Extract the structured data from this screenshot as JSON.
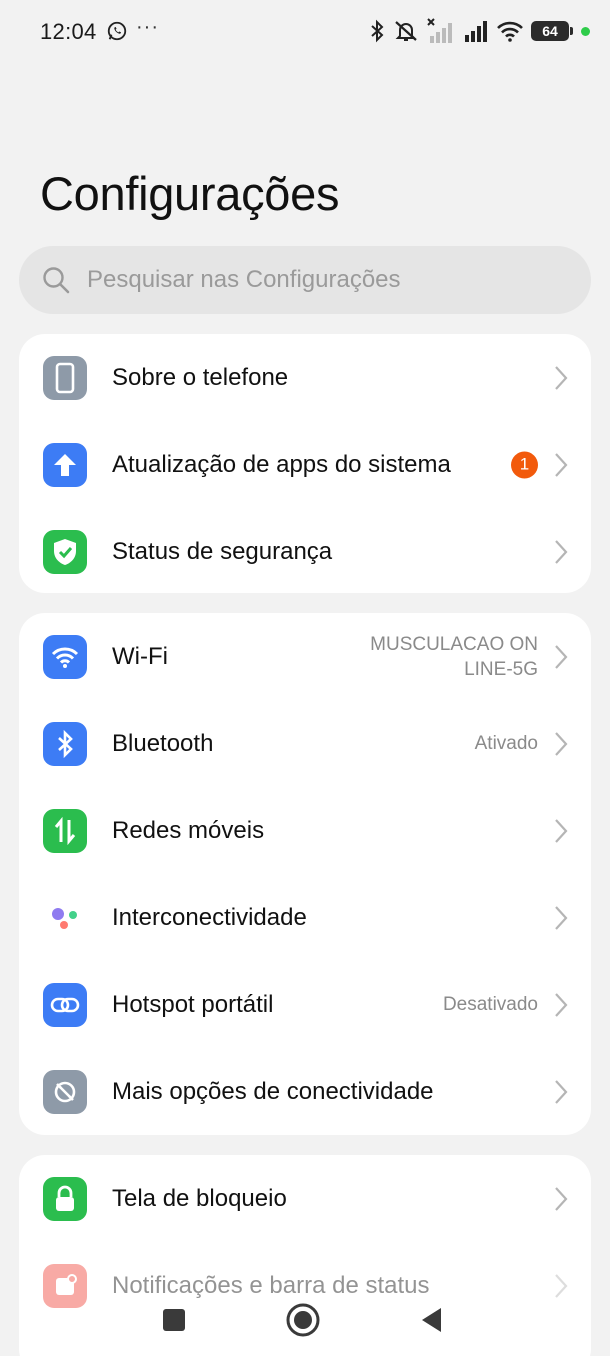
{
  "status_bar": {
    "time": "12:04",
    "more": "···",
    "battery": "64",
    "icons": [
      "whatsapp-icon",
      "bluetooth-icon",
      "mute-icon",
      "signal-off-icon",
      "signal-icon",
      "wifi-icon",
      "battery-icon"
    ]
  },
  "page": {
    "title": "Configurações"
  },
  "search": {
    "placeholder": "Pesquisar nas Configurações"
  },
  "groups": [
    {
      "items": [
        {
          "label": "Sobre o telefone",
          "icon": "phone-icon",
          "color": "#8e9aa8"
        },
        {
          "label": "Atualização de apps do sistema",
          "icon": "arrow-up-icon",
          "color": "#3d7cf5",
          "badge": "1"
        },
        {
          "label": "Status de segurança",
          "icon": "shield-icon",
          "color": "#2bbd4e"
        }
      ]
    },
    {
      "items": [
        {
          "label": "Wi-Fi",
          "icon": "wifi-icon",
          "color": "#3d7cf5",
          "value_line1": "MUSCULACAO ON",
          "value_line2": "LINE-5G"
        },
        {
          "label": "Bluetooth",
          "icon": "bluetooth-icon",
          "color": "#3d7cf5",
          "value": "Ativado"
        },
        {
          "label": "Redes móveis",
          "icon": "mobile-data-icon",
          "color": "#2bbd4e"
        },
        {
          "label": "Interconectividade",
          "icon": "interconnect-icon"
        },
        {
          "label": "Hotspot portátil",
          "icon": "hotspot-icon",
          "color": "#3d7cf5",
          "value": "Desativado"
        },
        {
          "label": "Mais opções de conectividade",
          "icon": "link-icon",
          "color": "#8e9aa8"
        }
      ]
    },
    {
      "items": [
        {
          "label": "Tela de bloqueio",
          "icon": "lock-icon",
          "color": "#2bbd4e"
        },
        {
          "label": "Notificações e barra de status",
          "icon": "notification-icon",
          "color": "#f0453a"
        }
      ]
    }
  ],
  "navbar": {
    "icons": [
      "recents-square-icon",
      "home-circle-icon",
      "back-triangle-icon"
    ]
  }
}
